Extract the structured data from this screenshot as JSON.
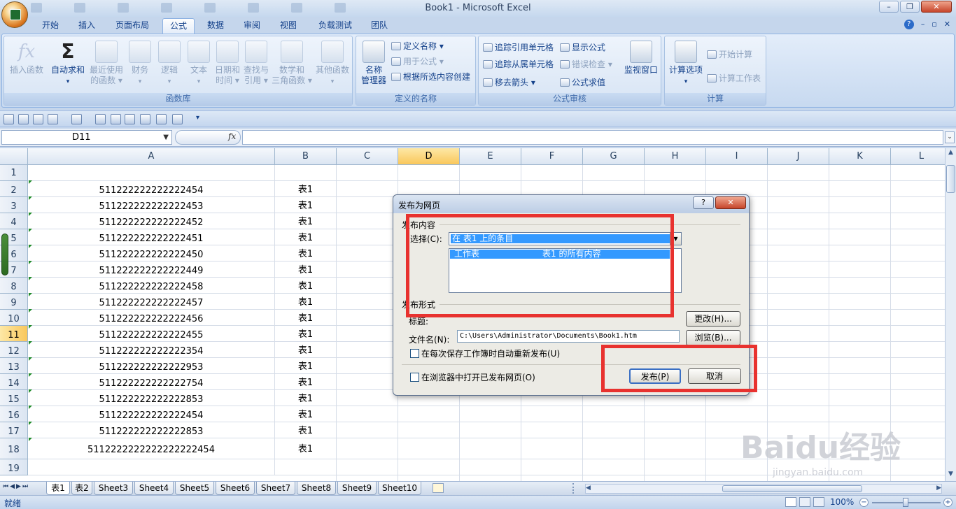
{
  "window": {
    "title": "Book1 - Microsoft Excel"
  },
  "tabs": [
    "开始",
    "插入",
    "页面布局",
    "公式",
    "数据",
    "审阅",
    "视图",
    "负载测试",
    "团队"
  ],
  "active_tab": "公式",
  "ribbon": {
    "func_lib": {
      "label": "函数库",
      "insert_function": "插入函数",
      "autosum": "自动求和",
      "recent_1": "最近使用",
      "recent_2": "的函数",
      "financial": "财务",
      "logical": "逻辑",
      "text": "文本",
      "datetime_1": "日期和",
      "datetime_2": "时间",
      "lookup_1": "查找与",
      "lookup_2": "引用",
      "math_1": "数学和",
      "math_2": "三角函数",
      "other": "其他函数"
    },
    "defined_names": {
      "label": "定义的名称",
      "name_manager_1": "名称",
      "name_manager_2": "管理器",
      "define_name": "定义名称",
      "use_in_formula": "用于公式",
      "create_from_selection": "根据所选内容创建"
    },
    "auditing": {
      "label": "公式审核",
      "trace_precedents": "追踪引用单元格",
      "trace_dependents": "追踪从属单元格",
      "remove_arrows": "移去箭头",
      "show_formulas": "显示公式",
      "error_checking": "错误检查",
      "evaluate_formula": "公式求值",
      "watch_window": "监视窗口"
    },
    "calculation": {
      "label": "计算",
      "calc_options": "计算选项",
      "calc_now": "开始计算",
      "calc_sheet": "计算工作表"
    }
  },
  "formula_bar": {
    "name_box": "D11",
    "fx": "fx",
    "content": ""
  },
  "columns": [
    "A",
    "B",
    "C",
    "D",
    "E",
    "F",
    "G",
    "H",
    "I",
    "J",
    "K",
    "L"
  ],
  "selected_column": "D",
  "selected_row": "11",
  "rows": [
    {
      "n": "1",
      "a": "",
      "b": ""
    },
    {
      "n": "2",
      "a": "511222222222222454",
      "b": "表1"
    },
    {
      "n": "3",
      "a": "511222222222222453",
      "b": "表1"
    },
    {
      "n": "4",
      "a": "511222222222222452",
      "b": "表1"
    },
    {
      "n": "5",
      "a": "511222222222222451",
      "b": "表1"
    },
    {
      "n": "6",
      "a": "511222222222222450",
      "b": "表1"
    },
    {
      "n": "7",
      "a": "511222222222222449",
      "b": "表1"
    },
    {
      "n": "8",
      "a": "511222222222222458",
      "b": "表1"
    },
    {
      "n": "9",
      "a": "511222222222222457",
      "b": "表1"
    },
    {
      "n": "10",
      "a": "511222222222222456",
      "b": "表1"
    },
    {
      "n": "11",
      "a": "511222222222222455",
      "b": "表1"
    },
    {
      "n": "12",
      "a": "511222222222222354",
      "b": "表1"
    },
    {
      "n": "13",
      "a": "511222222222222953",
      "b": "表1"
    },
    {
      "n": "14",
      "a": "511222222222222754",
      "b": "表1"
    },
    {
      "n": "15",
      "a": "511222222222222853",
      "b": "表1"
    },
    {
      "n": "16",
      "a": "511222222222222454",
      "b": "表1"
    },
    {
      "n": "17",
      "a": "511222222222222853",
      "b": "表1"
    },
    {
      "n": "18",
      "a": "5112222222222222222454",
      "b": "表1"
    },
    {
      "n": "19",
      "a": "",
      "b": ""
    }
  ],
  "sheet_tabs": [
    "表1",
    "表2",
    "Sheet3",
    "Sheet4",
    "Sheet5",
    "Sheet6",
    "Sheet7",
    "Sheet8",
    "Sheet9",
    "Sheet10"
  ],
  "active_sheet": "表1",
  "status": {
    "ready": "就绪",
    "zoom": "100%"
  },
  "dialog": {
    "title": "发布为网页",
    "help": "?",
    "close": "✕",
    "content_label": "发布内容",
    "select_label": "选择(C):",
    "select_value": "在 表1 上的条目",
    "list_item_col1": "工作表",
    "list_item_col2": "表1 的所有内容",
    "format_label": "发布形式",
    "title_label": "标题:",
    "change_button": "更改(H)...",
    "filename_label": "文件名(N):",
    "filename_value": "C:\\Users\\Administrator\\Documents\\Book1.htm",
    "browse_button": "浏览(B)...",
    "autorepublish": "在每次保存工作簿时自动重新发布(U)",
    "open_in_browser": "在浏览器中打开已发布网页(O)",
    "publish_button": "发布(P)",
    "cancel_button": "取消"
  },
  "watermark": {
    "logo": "Baidu经验",
    "url": "jingyan.baidu.com"
  },
  "colors": {
    "highlight": "#e8322f",
    "selection": "#3399ff",
    "ribbon": "#dbe7f5"
  }
}
